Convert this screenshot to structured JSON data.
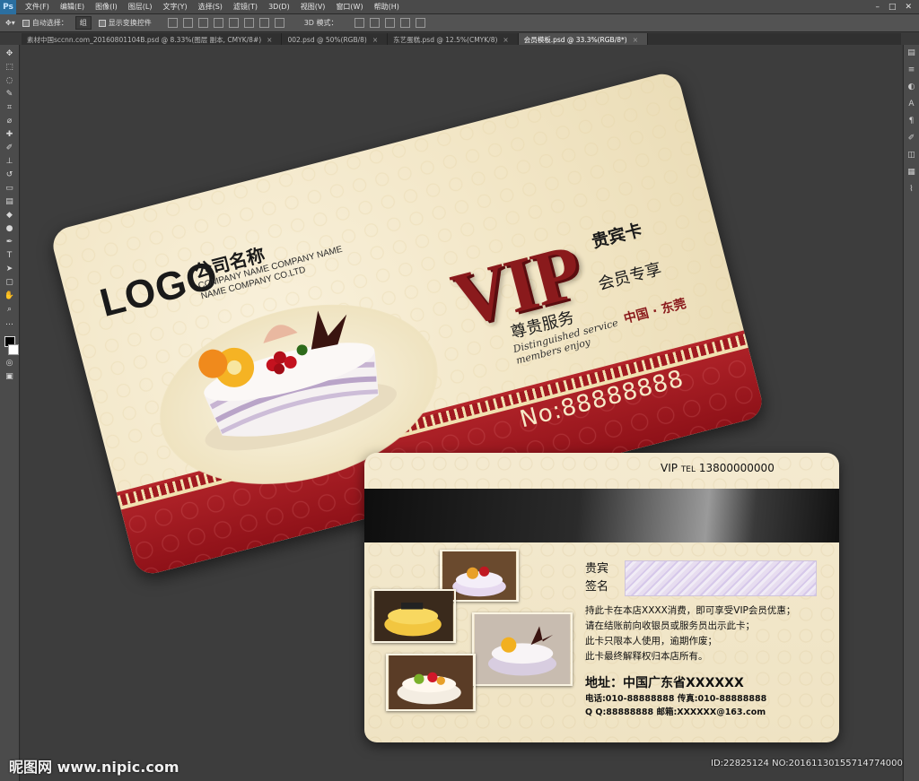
{
  "app": {
    "logo": "Ps",
    "menu": [
      "文件(F)",
      "编辑(E)",
      "图像(I)",
      "图层(L)",
      "文字(Y)",
      "选择(S)",
      "滤镜(T)",
      "3D(D)",
      "视图(V)",
      "窗口(W)",
      "帮助(H)"
    ],
    "options": {
      "auto_select_label": "自动选择：",
      "auto_select_value": "组",
      "show_transform_label": "显示变换控件",
      "mode_3d_label": "3D 模式："
    },
    "tabs": [
      {
        "label": "素材中国sccnn.com_20160801104B.psd @ 8.33%(图层 副本, CMYK/8#)",
        "active": false
      },
      {
        "label": "002.psd @ 50%(RGB/8)",
        "active": false
      },
      {
        "label": "东艺蛋糕.psd @ 12.5%(CMYK/8)",
        "active": false
      },
      {
        "label": "会员模板.psd @ 33.3%(RGB/8*)",
        "active": true
      }
    ]
  },
  "front_card": {
    "logo": "LOGO",
    "company_cn": "公司名称",
    "company_en_1": "COMPANY NAME COMPANY NAME",
    "company_en_2": "NAME COMPANY CO.LTD",
    "vip": "VIP",
    "vip_card_cn": "贵宾卡",
    "slogan_service": "尊贵服务",
    "slogan_member": "会员专享",
    "script_1": "Distinguished service",
    "script_2": "members enjoy",
    "location": "中国 · 东莞",
    "card_no": "No:88888888"
  },
  "back_card": {
    "vip_tel_prefix": "VIP",
    "tel_label": "TEL",
    "tel_number": "13800000000",
    "sig_label_1": "贵宾",
    "sig_label_2": "签名",
    "terms": [
      "持此卡在本店XXXX消费，即可享受VIP会员优惠；",
      "请在结账前向收银员或服务员出示此卡；",
      "此卡只限本人使用，逾期作废；",
      "此卡最终解释权归本店所有。"
    ],
    "address": "地址：中国广东省XXXXXX",
    "phone_line": "电话:010-88888888  传真:010-88888888",
    "qq_line": "Q Q:88888888  邮箱:XXXXXX@163.com"
  },
  "watermark": {
    "site": "昵图网 www.nipic.com",
    "id_line": "ID:22825124 NO:20161130155714774000"
  },
  "colors": {
    "card_red": "#9e1a20",
    "card_cream": "#f2e6c6",
    "ps_background": "#3a3a3a"
  }
}
